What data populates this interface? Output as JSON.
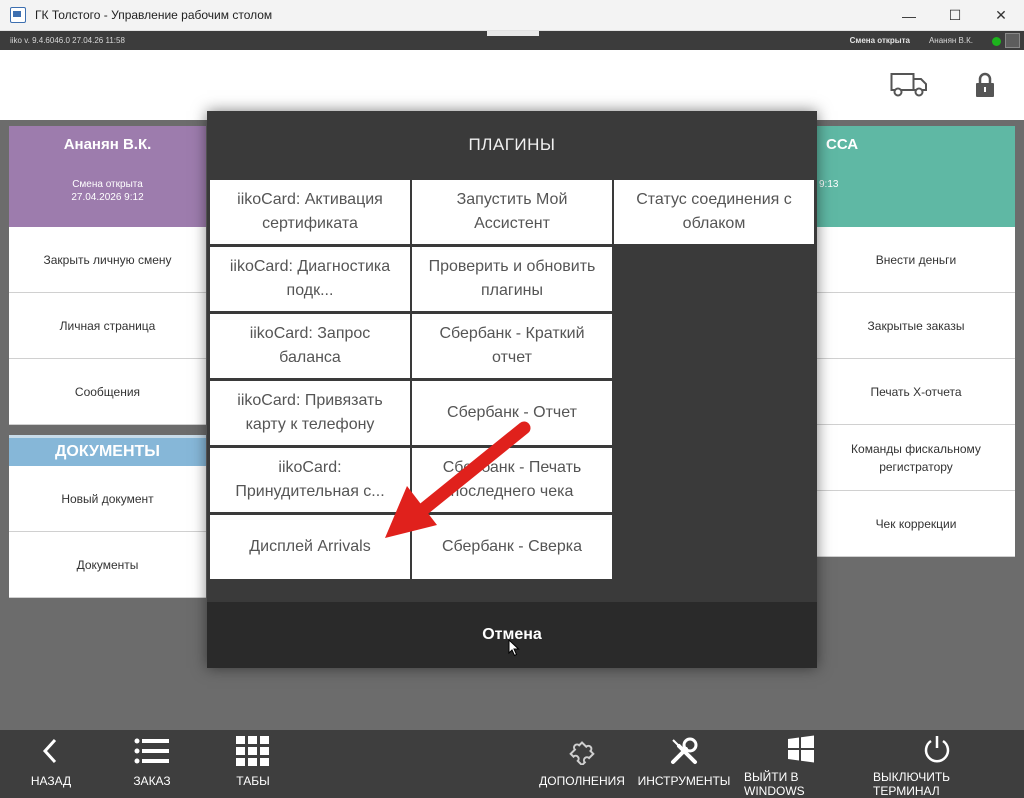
{
  "window": {
    "title": "ГК Толстого - Управление рабочим столом",
    "minimize": "—",
    "maximize": "☐",
    "close": "✕"
  },
  "status": {
    "app": "iiko  v. 9.4.6046.0     27.04.26   11:58",
    "shift": "Смена открыта",
    "user": "Ананян В.К."
  },
  "left": {
    "name": "Ананян В.К.",
    "shift_status": "Смена открыта",
    "shift_date": "27.04.2026 9:12",
    "buttons": [
      "Закрыть личную смену",
      "Личная страница",
      "Сообщения"
    ],
    "docs_title": "ДОКУМЕНТЫ",
    "doc_buttons": [
      "Новый документ",
      "Документы"
    ]
  },
  "right": {
    "title": "ССА",
    "time": "9:13",
    "buttons": [
      "Внести деньги",
      "Закрытые заказы",
      "Печать X-отчета",
      "Команды фискальному регистратору",
      "Чек коррекции"
    ]
  },
  "dialog": {
    "title": "ПЛАГИНЫ",
    "plugins": [
      "iikoCard: Активация сертификата",
      "Запустить Мой Ассистент",
      "Статус соединения с облаком",
      "iikoCard: Диагностика подк...",
      "Проверить и обновить плагины",
      "iikoCard: Запрос баланса",
      "Сбербанк - Краткий отчет",
      "iikoCard: Привязать карту к телефону",
      "Сбербанк - Отчет",
      "iikoCard: Принудительная с...",
      "Сбербанк - Печать последнего чека",
      "Дисплей Arrivals",
      "Сбербанк - Сверка"
    ],
    "cancel": "Отмена"
  },
  "toolbar": {
    "back": "НАЗАД",
    "order": "ЗАКАЗ",
    "tabs": "ТАБЫ",
    "addons": "ДОПОЛНЕНИЯ",
    "tools": "ИНСТРУМЕНТЫ",
    "exit_windows": "ВЫЙТИ В WINDOWS",
    "shutdown": "ВЫКЛЮЧИТЬ ТЕРМИНАЛ"
  },
  "colors": {
    "purple": "#9d7cad",
    "teal": "#5fb8a4",
    "docs_blue": "#86b7d8",
    "arrow_red": "#e0211c"
  }
}
